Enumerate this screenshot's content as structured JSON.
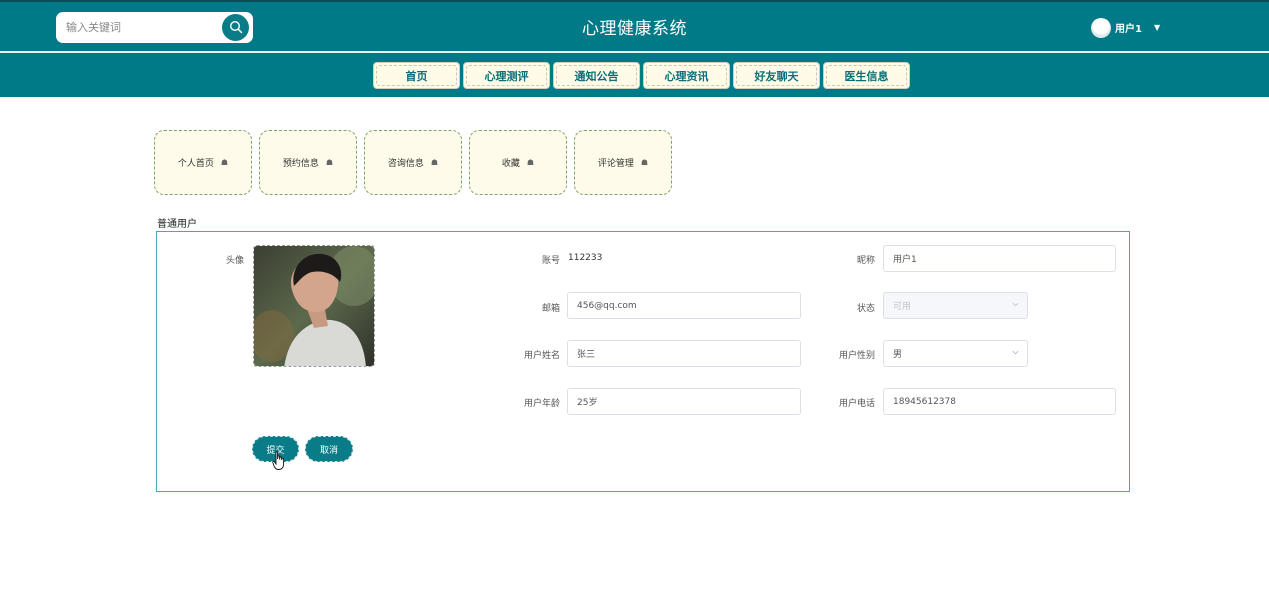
{
  "header": {
    "title": "心理健康系统",
    "search": {
      "placeholder": "输入关键词"
    },
    "user": {
      "name": "用户1"
    }
  },
  "nav": {
    "items": [
      "首页",
      "心理测评",
      "通知公告",
      "心理资讯",
      "好友聊天",
      "医生信息"
    ]
  },
  "submenu": {
    "items": [
      "个人首页",
      "预约信息",
      "咨询信息",
      "收藏",
      "评论管理"
    ]
  },
  "form": {
    "section_title": "普通用户",
    "avatar_label": "头像",
    "account": {
      "label": "账号",
      "value": "112233"
    },
    "nickname": {
      "label": "昵称",
      "value": "用户1"
    },
    "email": {
      "label": "邮箱",
      "value": "456@qq.com"
    },
    "status": {
      "label": "状态",
      "value": "可用"
    },
    "real_name": {
      "label": "用户姓名",
      "value": "张三"
    },
    "gender": {
      "label": "用户性别",
      "value": "男"
    },
    "age": {
      "label": "用户年龄",
      "value": "25岁"
    },
    "phone": {
      "label": "用户电话",
      "value": "18945612378"
    },
    "submit_label": "提交",
    "cancel_label": "取消"
  },
  "colors": {
    "header_bg": "#007a87",
    "nav_bg": "#fffbe6",
    "card_bg": "#fffbea",
    "accent": "#0a7c88"
  }
}
